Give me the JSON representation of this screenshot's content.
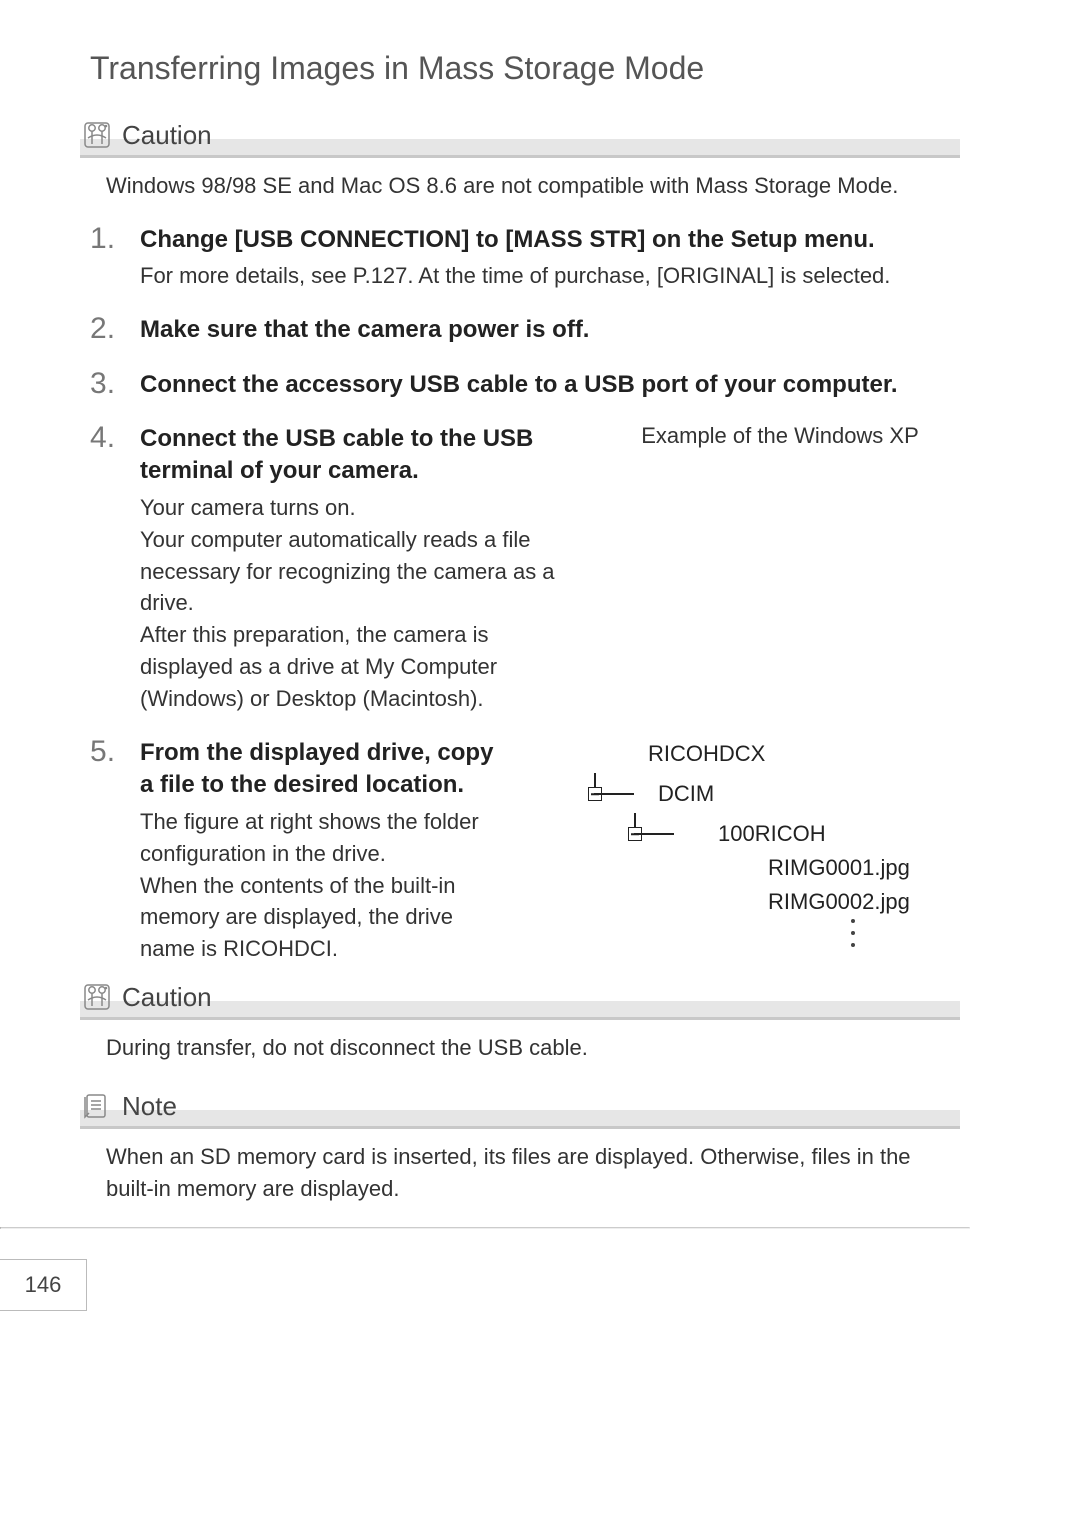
{
  "section_title": "Transferring Images in Mass Storage Mode",
  "caution1": {
    "title": "Caution",
    "body": "Windows 98/98 SE and Mac OS 8.6 are not compatible with Mass Storage Mode."
  },
  "steps": [
    {
      "head": "Change [USB CONNECTION] to [MASS STR] on the Setup menu.",
      "body": "For more details, see P.127. At the time of purchase, [ORIGINAL] is selected."
    },
    {
      "head": "Make sure that the camera power is off."
    },
    {
      "head": "Connect the accessory USB cable to a USB port of your computer."
    },
    {
      "head": "Connect the USB cable to the USB terminal of your camera.",
      "body": "Your camera turns on.\nYour computer automatically reads a file necessary for recognizing the camera as a drive.\nAfter this preparation, the camera is displayed as a drive at My Computer (Windows) or Desktop (Macintosh).",
      "aside_caption": "Example of the Windows XP"
    },
    {
      "head": "From the displayed drive, copy a file to the desired location.",
      "body": "The figure at right shows the folder configuration in the drive.\nWhen the contents of the built-in memory are displayed, the drive name is RICOHDCI."
    }
  ],
  "folder_tree": {
    "root": "RICOHDCX",
    "l1": "DCIM",
    "l2": "100RICOH",
    "files": [
      "RIMG0001.jpg",
      "RIMG0002.jpg"
    ]
  },
  "caution2": {
    "title": "Caution",
    "body": "During transfer, do not disconnect the USB cable."
  },
  "note": {
    "title": "Note",
    "body": "When an SD memory card is inserted, its files are displayed. Otherwise, files in the built-in memory are displayed."
  },
  "page_number": "146"
}
